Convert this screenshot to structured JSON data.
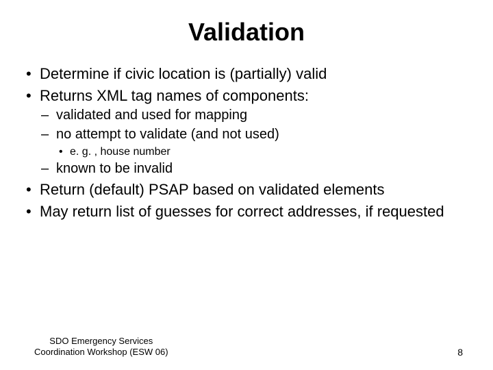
{
  "title": "Validation",
  "bullets": {
    "b1": "Determine if civic location is (partially) valid",
    "b2": "Returns XML tag names of components:",
    "b2a": "validated and used for mapping",
    "b2b": "no attempt to validate (and not used)",
    "b2b1": "e. g. , house number",
    "b2c": "known to be invalid",
    "b3": "Return (default) PSAP based on validated elements",
    "b4": "May return list of guesses for correct addresses, if requested"
  },
  "footer": {
    "line1": "SDO Emergency Services",
    "line2": "Coordination Workshop (ESW 06)",
    "page": "8"
  }
}
